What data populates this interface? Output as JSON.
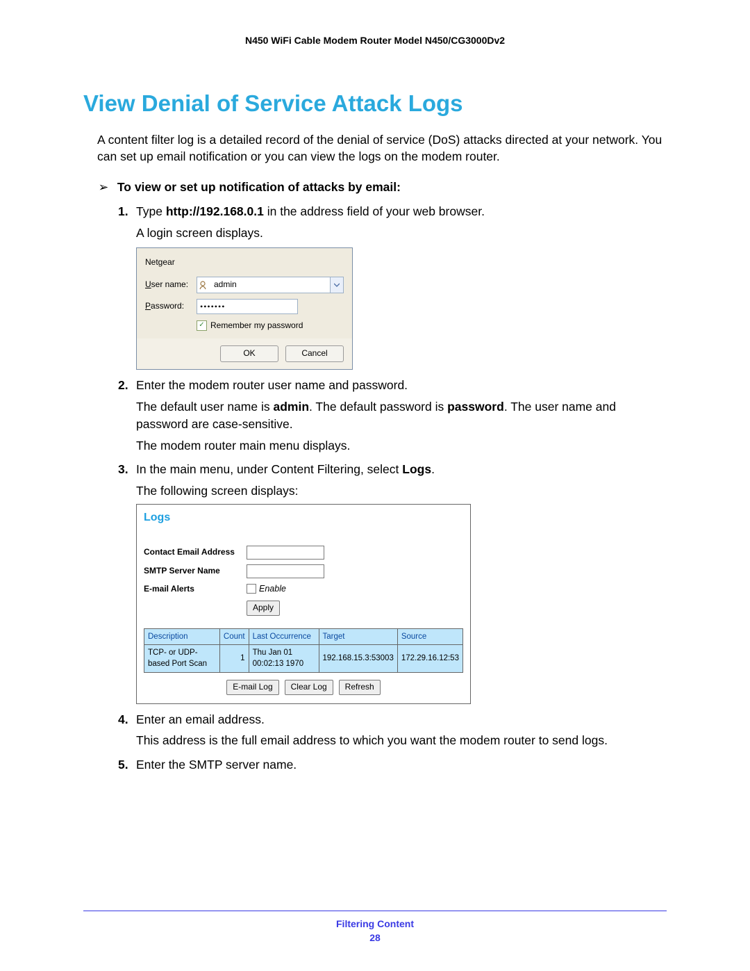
{
  "doc_header": "N450 WiFi Cable Modem Router Model N450/CG3000Dv2",
  "section_title": "View Denial of Service Attack Logs",
  "intro": "A content filter log is a detailed record of the denial of service (DoS) attacks directed at your network. You can set up email notification or you can view the logs on the modem router.",
  "step_head": "To view or set up notification of attacks by email:",
  "step1_a": "Type ",
  "step1_url": "http://192.168.0.1",
  "step1_b": " in the address field of your web browser.",
  "step1_c": "A login screen displays.",
  "login": {
    "brand": "Netgear",
    "user_label_u": "U",
    "user_label_rest": "ser name:",
    "user_value": "admin",
    "pass_label_p": "P",
    "pass_label_rest": "assword:",
    "pass_masked": "•••••••",
    "remember_r": "R",
    "remember_rest": "emember my password",
    "ok": "OK",
    "cancel": "Cancel"
  },
  "step2_a": "Enter the modem router user name and password.",
  "step2_b1": "The default user name is ",
  "step2_admin": "admin",
  "step2_b2": ". The default password is ",
  "step2_password": "password",
  "step2_b3": ". The user name and password are case-sensitive.",
  "step2_c": "The modem router main menu displays.",
  "step3_a1": "In the main menu, under Content Filtering, select ",
  "step3_logs": "Logs",
  "step3_a2": ".",
  "step3_b": "The following screen displays:",
  "logs_panel": {
    "title": "Logs",
    "contact": "Contact Email Address",
    "smtp": "SMTP Server Name",
    "alerts": "E-mail Alerts",
    "enable": "Enable",
    "apply": "Apply",
    "headers": {
      "desc": "Description",
      "count": "Count",
      "last": "Last Occurrence",
      "target": "Target",
      "source": "Source"
    },
    "row": {
      "desc": "TCP- or UDP-based Port Scan",
      "count": "1",
      "last": "Thu Jan 01 00:02:13 1970",
      "target": "192.168.15.3:53003",
      "source": "172.29.16.12:53"
    },
    "buttons": {
      "email": "E-mail Log",
      "clear": "Clear Log",
      "refresh": "Refresh"
    }
  },
  "step4_a": "Enter an email address.",
  "step4_b": "This address is the full email address to which you want the modem router to send logs.",
  "step5_a": "Enter the SMTP server name.",
  "footer": {
    "section": "Filtering Content",
    "page": "28"
  }
}
